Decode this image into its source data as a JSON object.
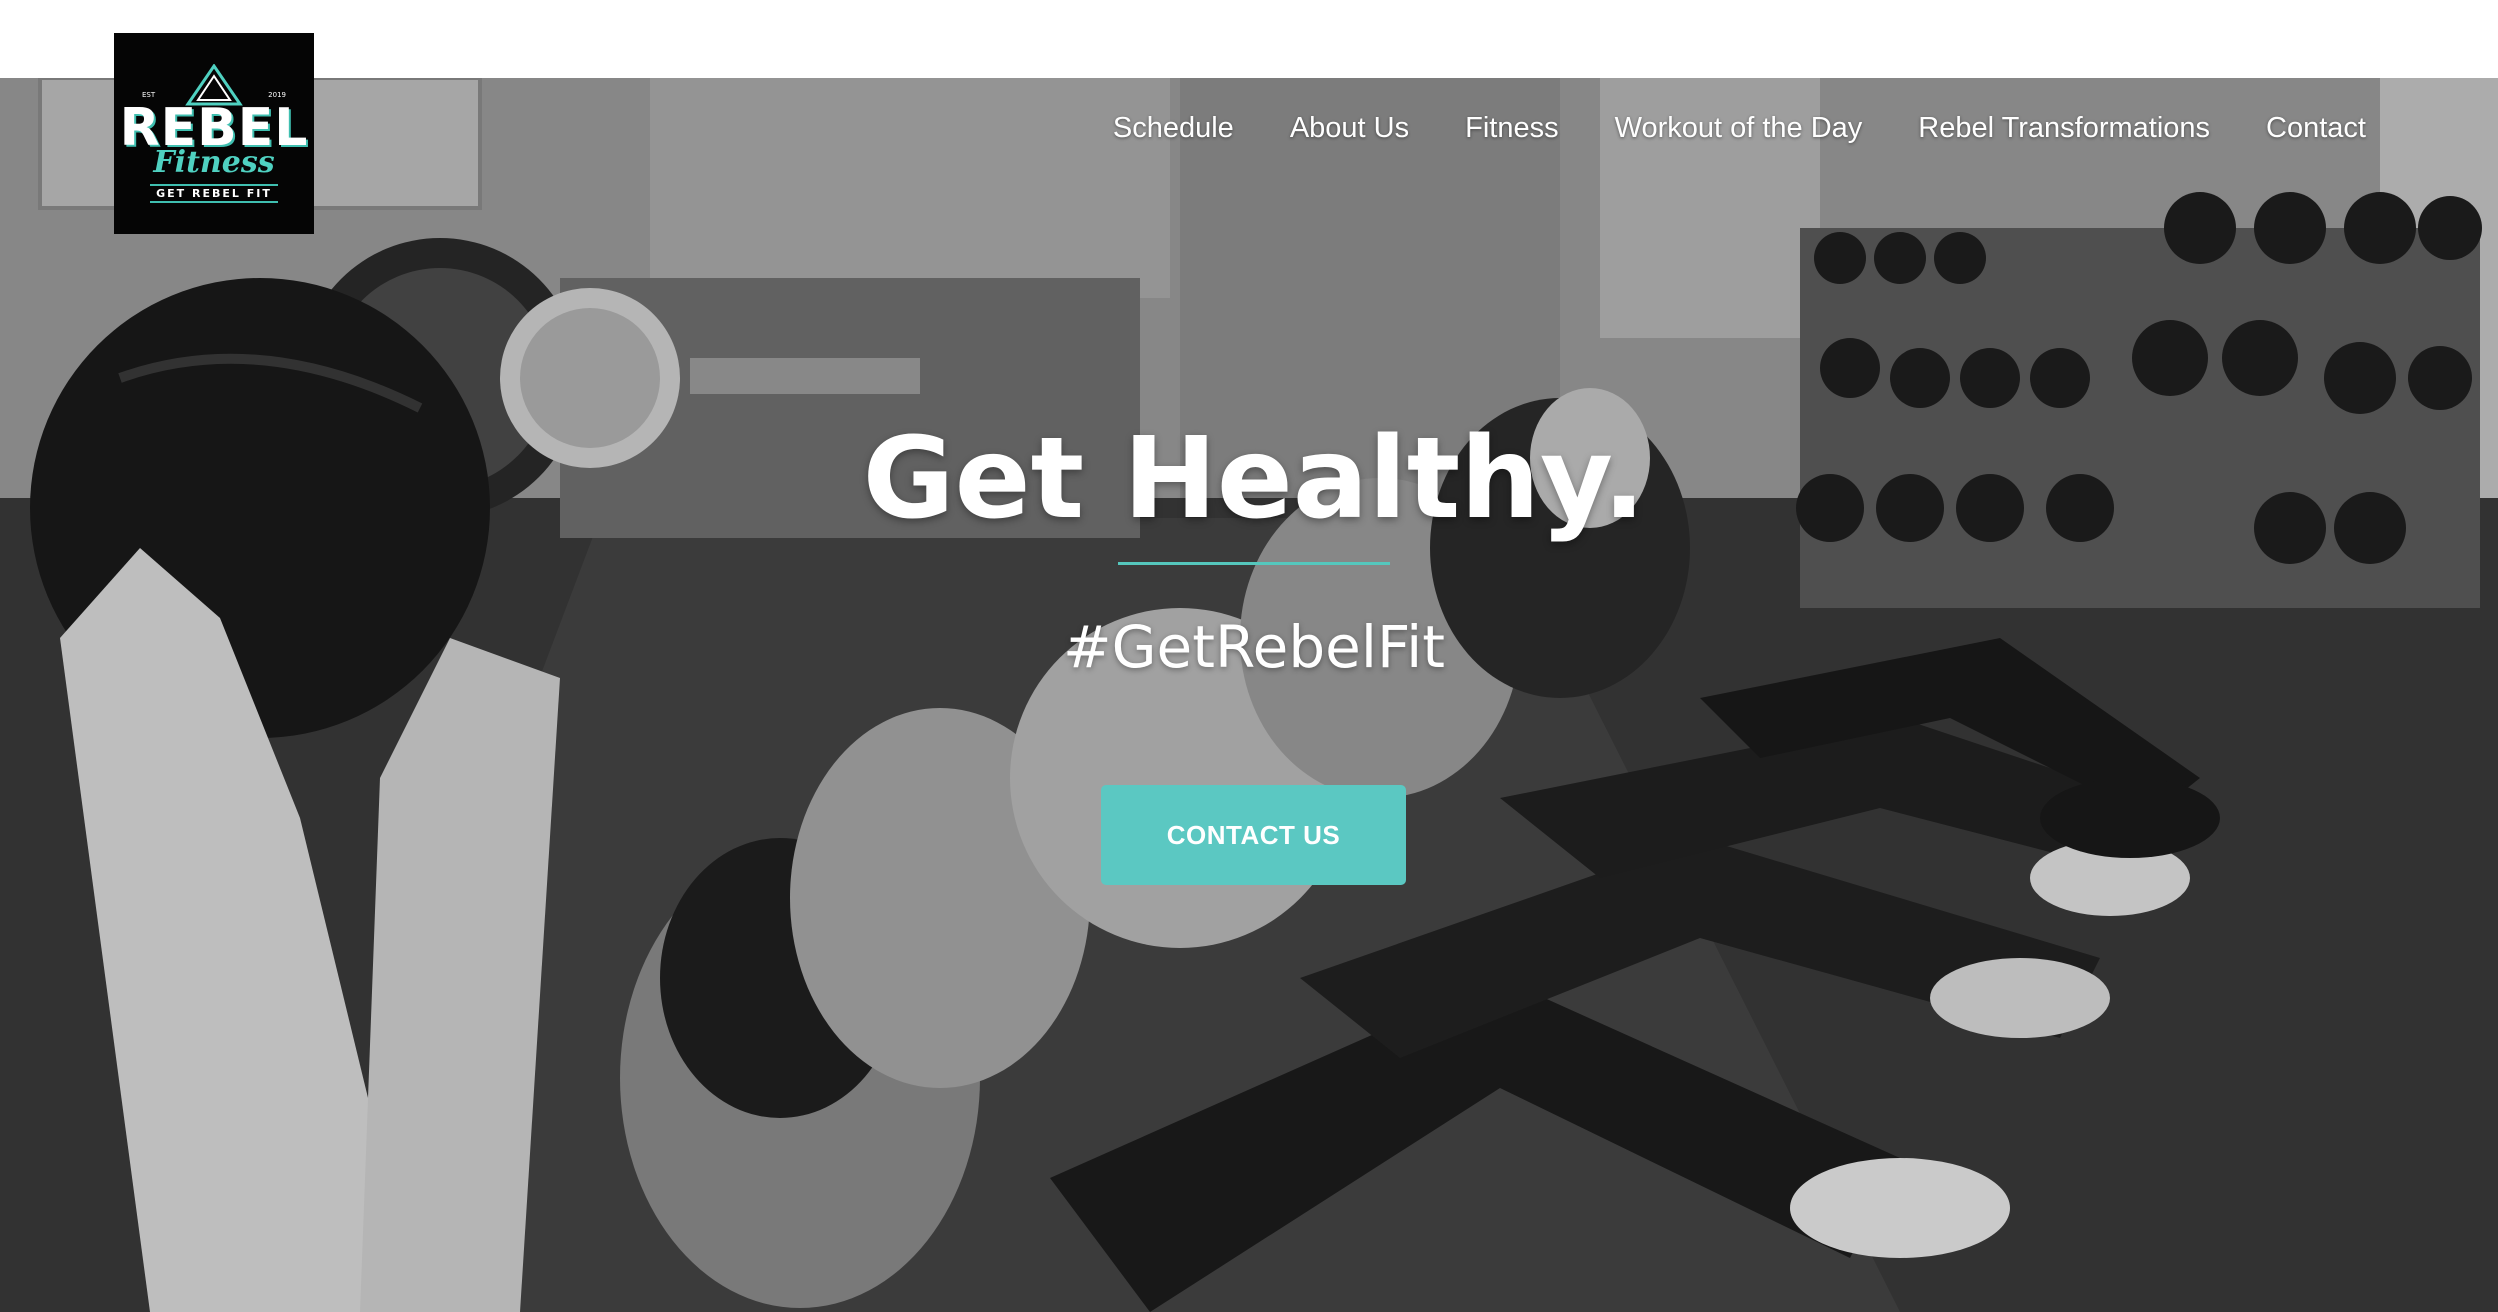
{
  "logo": {
    "est": "EST",
    "year": "2019",
    "word": "REBEL",
    "script": "Fitness",
    "tagline": "GET REBEL FIT"
  },
  "nav": {
    "items": [
      {
        "label": "Schedule"
      },
      {
        "label": "About Us"
      },
      {
        "label": "Fitness"
      },
      {
        "label": "Workout of the Day"
      },
      {
        "label": "Rebel Transformations"
      },
      {
        "label": "Contact"
      }
    ]
  },
  "hero": {
    "headline": "Get Healthy.",
    "hashtag": "#GetRebelFit",
    "cta_label": "CONTACT US"
  },
  "colors": {
    "accent": "#5bc8c2",
    "divider": "#55c7bd",
    "logo_bg": "#050505",
    "nav_text": "#ffffff"
  }
}
